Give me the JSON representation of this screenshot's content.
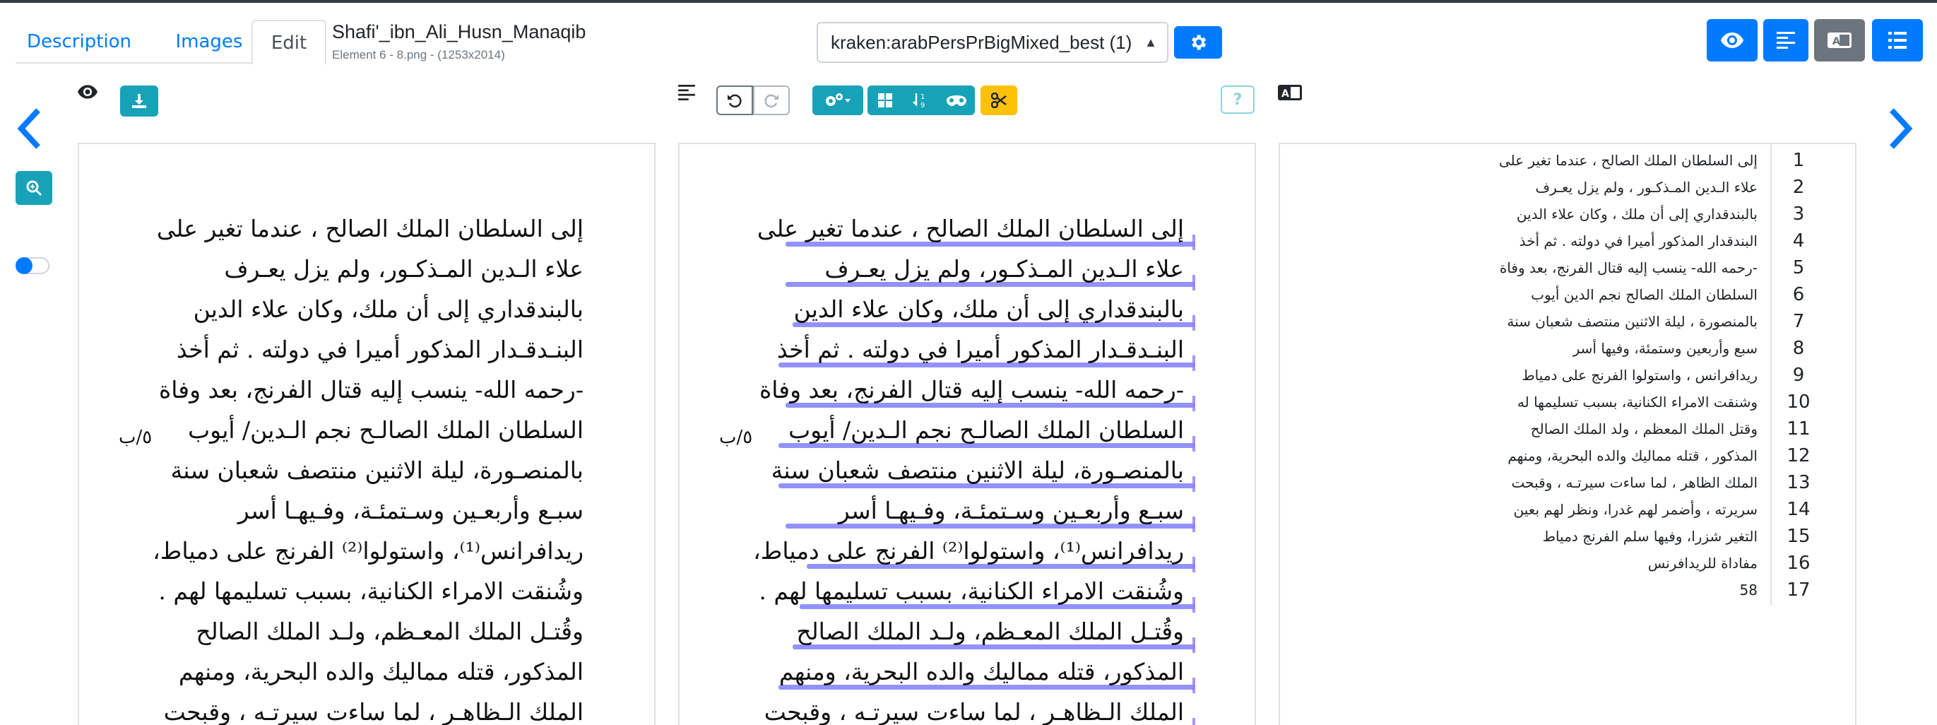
{
  "tabs": [
    {
      "label": "Description"
    },
    {
      "label": "Images"
    },
    {
      "label": "Edit"
    }
  ],
  "document": {
    "title": "Shafi'_ibn_Ali_Husn_Manaqib",
    "subtitle": "Element 6 - 8.png - (1253x2014)"
  },
  "model_select": {
    "value": "kraken:arabPersPrBigMixed_best (1)"
  },
  "colors": {
    "primary": "#007bff",
    "info": "#17a2b8",
    "warning": "#ffc107",
    "secondary": "#6c757d",
    "baseline": "#6e6eff"
  },
  "toolbar": {
    "help_label": "?"
  },
  "page": {
    "margin_note": "٥/ب",
    "lines": [
      "إلى السلطان الملك الصالح ، عندما تغير على",
      "علاء الـدين المـذكـور، ولم يزل يعـرف",
      "بالبندقداري إلى أن ملك، وكان علاء الدين",
      "البنـدقـدار المذكور أميرا في دولته . ثم أخذ",
      "-رحمه الله- ينسب إليه قتال الفرنج، بعد وفاة",
      "السلطان الملك الصالـح نجم الـدين/ أيوب",
      "بالمنصـورة، ليلة الاثنين منتصف شعبان سنة",
      "سبـع وأربعـين وسـتمئـة، وفـيهـا أسر",
      "ريدافرانس⁽¹⁾، واستولوا⁽²⁾ الفرنج على دمياط،",
      "وشُنقت الامراء الكنانية، بسبب تسليمها لهم .",
      "وقُتـل الملك المعـظم، ولـد الملك الصالح",
      "المذكور، قتله مماليك والده البحرية، ومنهم",
      "الملك الـظاهـر ، لما ساءت سيرتـه ، وقبحت"
    ]
  },
  "transcription": [
    {
      "num": "1",
      "text": "إلى السلطان الملك الصالح ، عندما تغير على"
    },
    {
      "num": "2",
      "text": "علاء الـدين المـذكـور ، ولم يزل يعـرف"
    },
    {
      "num": "3",
      "text": "بالبندقداري إلى أن ملك ، وكان علاء الدين"
    },
    {
      "num": "4",
      "text": "البندقدار المذكور أميرا في دولته . ثم أخذ"
    },
    {
      "num": "5",
      "text": "-رحمه الله- ينسب إليه قتال الفرنج، بعد وفاة"
    },
    {
      "num": "6",
      "text": "السلطان الملك الصالح نجم الدين أيوب"
    },
    {
      "num": "7",
      "text": "بالمنصورة ، ليلة الاثنين منتصف شعبان سنة"
    },
    {
      "num": "8",
      "text": "سبع وأربعين وستمئة، وفيها أسر"
    },
    {
      "num": "9",
      "text": "ريدافرانس ، واستولوا الفرنج على دمياط"
    },
    {
      "num": "10",
      "text": "وشنقت الامراء الكنانية، بسبب تسليمها له"
    },
    {
      "num": "11",
      "text": "وقتل الملك المعظم ، ولد الملك الصالح"
    },
    {
      "num": "12",
      "text": "المذكور ، قتله مماليك والده البحرية، ومنهم"
    },
    {
      "num": "13",
      "text": "الملك الظاهر ، لما ساءت سيرتـه ، وقبحت"
    },
    {
      "num": "14",
      "text": "سريرته ، وأضمر لهم غدرا، ونظر لهم بعين"
    },
    {
      "num": "15",
      "text": "التغير شزرا، وفيها سلم الفرنج دمياط"
    },
    {
      "num": "16",
      "text": "مفاداة للريدافرنس"
    },
    {
      "num": "17",
      "text": "58"
    }
  ]
}
